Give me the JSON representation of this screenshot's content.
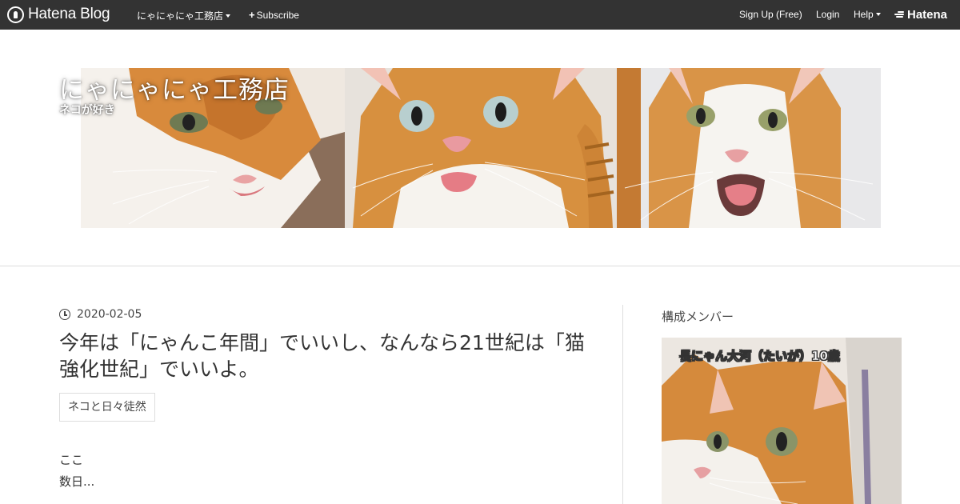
{
  "topbar": {
    "logo_text": "Hatena Blog",
    "blog_menu": "にゃにゃにゃ工務店",
    "subscribe": "Subscribe",
    "signup": "Sign Up (Free)",
    "login": "Login",
    "help": "Help",
    "hatena": "Hatena"
  },
  "header": {
    "title": "にゃにゃにゃ工務店",
    "description": "ネコが好き"
  },
  "entry": {
    "date": "2020-02-05",
    "title": "今年は「にゃんこ年間」でいいし、なんなら21世紀は「猫強化世紀」でいいよ。",
    "category": "ネコと日々徒然",
    "body_line1": "ここ",
    "body_line2": "数日..."
  },
  "sidebar": {
    "title": "構成メンバー",
    "image_caption": "長にゃん大河（たいが）10歳"
  },
  "colors": {
    "topbar_bg": "#333333",
    "divider": "#dddddd",
    "cat_orange": "#d98a3e",
    "cat_white": "#f4f1ec"
  }
}
